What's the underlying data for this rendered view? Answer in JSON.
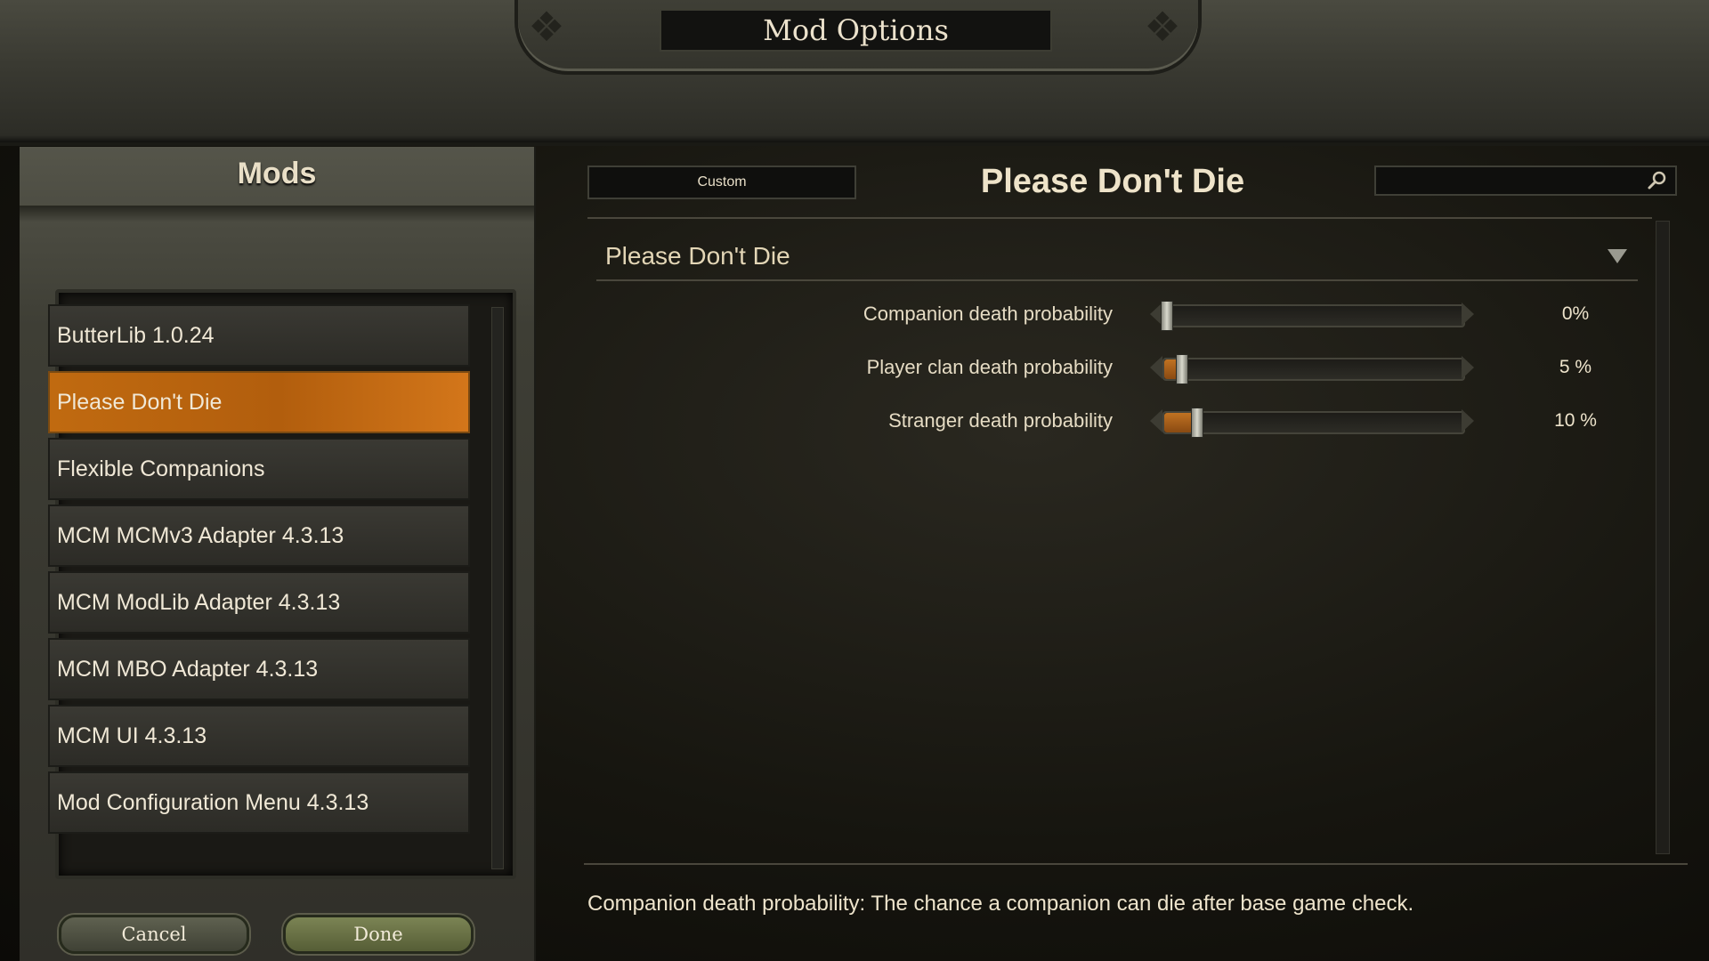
{
  "window": {
    "title": "Mod Options"
  },
  "left_panel": {
    "header": "Mods",
    "mods": [
      {
        "label": "ButterLib 1.0.24",
        "selected": false
      },
      {
        "label": "Please Don't Die",
        "selected": true
      },
      {
        "label": "Flexible Companions",
        "selected": false
      },
      {
        "label": "MCM MCMv3 Adapter 4.3.13",
        "selected": false
      },
      {
        "label": "MCM ModLib Adapter 4.3.13",
        "selected": false
      },
      {
        "label": "MCM MBO Adapter 4.3.13",
        "selected": false
      },
      {
        "label": "MCM UI 4.3.13",
        "selected": false
      },
      {
        "label": "Mod Configuration Menu 4.3.13",
        "selected": false
      }
    ],
    "buttons": {
      "cancel": "Cancel",
      "done": "Done"
    }
  },
  "right_panel": {
    "preset": "Custom",
    "mod_title": "Please Don't Die",
    "search": {
      "value": "",
      "placeholder": ""
    },
    "group": {
      "title": "Please Don't Die",
      "expanded": true
    },
    "settings": [
      {
        "label": "Companion death probability",
        "value_text": "0%",
        "value": 0
      },
      {
        "label": "Player clan death probability",
        "value_text": "5 %",
        "value": 5
      },
      {
        "label": "Stranger death probability",
        "value_text": "10 %",
        "value": 10
      }
    ],
    "description": "Companion death probability: The chance a companion can die after base game check."
  },
  "icons": {
    "search": "search-icon",
    "collapse": "triangle-down-icon",
    "corner_knot": "knot-ornament-icon"
  },
  "colors": {
    "selected_item": "#c06a10",
    "slider_fill": "#c07222",
    "text": "#e8dcc0"
  }
}
